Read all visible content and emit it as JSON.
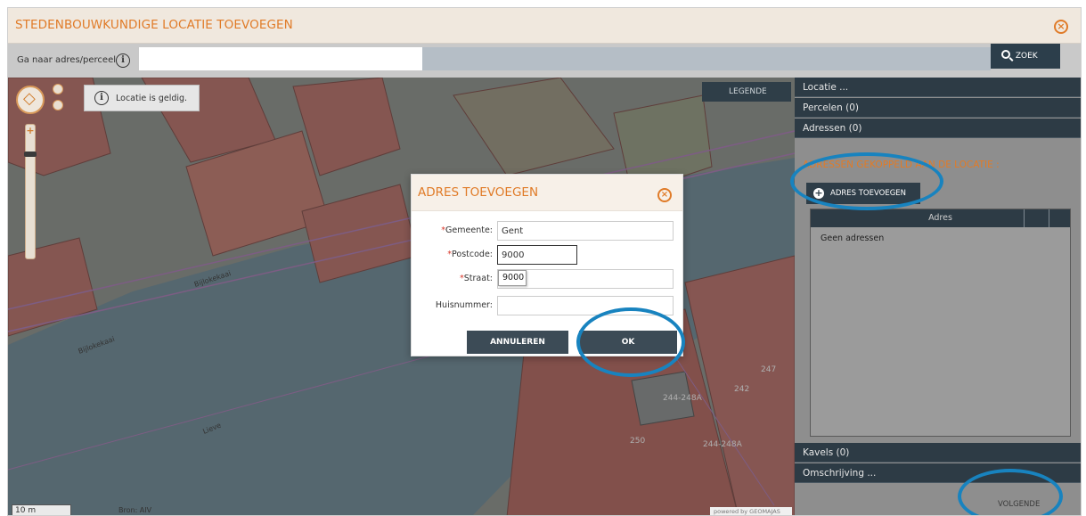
{
  "window": {
    "title": "STEDENBOUWKUNDIGE LOCATIE TOEVOEGEN",
    "close_icon": "close-circle-icon"
  },
  "search": {
    "label": "Ga naar adres/perceel",
    "value": "",
    "button_label": "ZOEK",
    "info_icon": "info-icon"
  },
  "map": {
    "status_text": "Locatie is geldig.",
    "legend_label": "LEGENDE",
    "scale_label": "10 m",
    "source_label": "Bron: AIV",
    "powered_by": "powered by GEOMAJAS",
    "street_labels": [
      "Bijlokekaai",
      "Bijlokekaai",
      "Lieve"
    ],
    "parcel_labels": [
      "244-248A",
      "244-248A",
      "250",
      "247",
      "242"
    ]
  },
  "panel": {
    "sections": [
      {
        "label": "Locatie ..."
      },
      {
        "label": "Percelen (0)"
      },
      {
        "label": "Adressen (0)"
      },
      {
        "label": "Kavels (0)"
      },
      {
        "label": "Omschrijving ..."
      }
    ],
    "addresses_heading": "ADRESSEN GEKOPPELD AAN DE LOCATIE :",
    "add_address_button": "ADRES TOEVOEGEN",
    "table_header": "Adres",
    "empty_text": "Geen adressen",
    "next_button": "VOLGENDE"
  },
  "dialog": {
    "title": "ADRES TOEVOEGEN",
    "fields": {
      "gemeente": {
        "label": "Gemeente:",
        "value": "Gent",
        "required": true
      },
      "postcode": {
        "label": "Postcode:",
        "value": "9000",
        "required": true
      },
      "straat": {
        "label": "Straat:",
        "value": "",
        "required": true
      },
      "huisnummer": {
        "label": "Huisnummer:",
        "value": "",
        "required": false
      }
    },
    "autocomplete_option": "9000",
    "cancel_label": "ANNULEREN",
    "ok_label": "OK"
  },
  "colors": {
    "accent": "#e07b28",
    "dark_bar": "#2d3b45",
    "annotation": "#1883bf"
  }
}
